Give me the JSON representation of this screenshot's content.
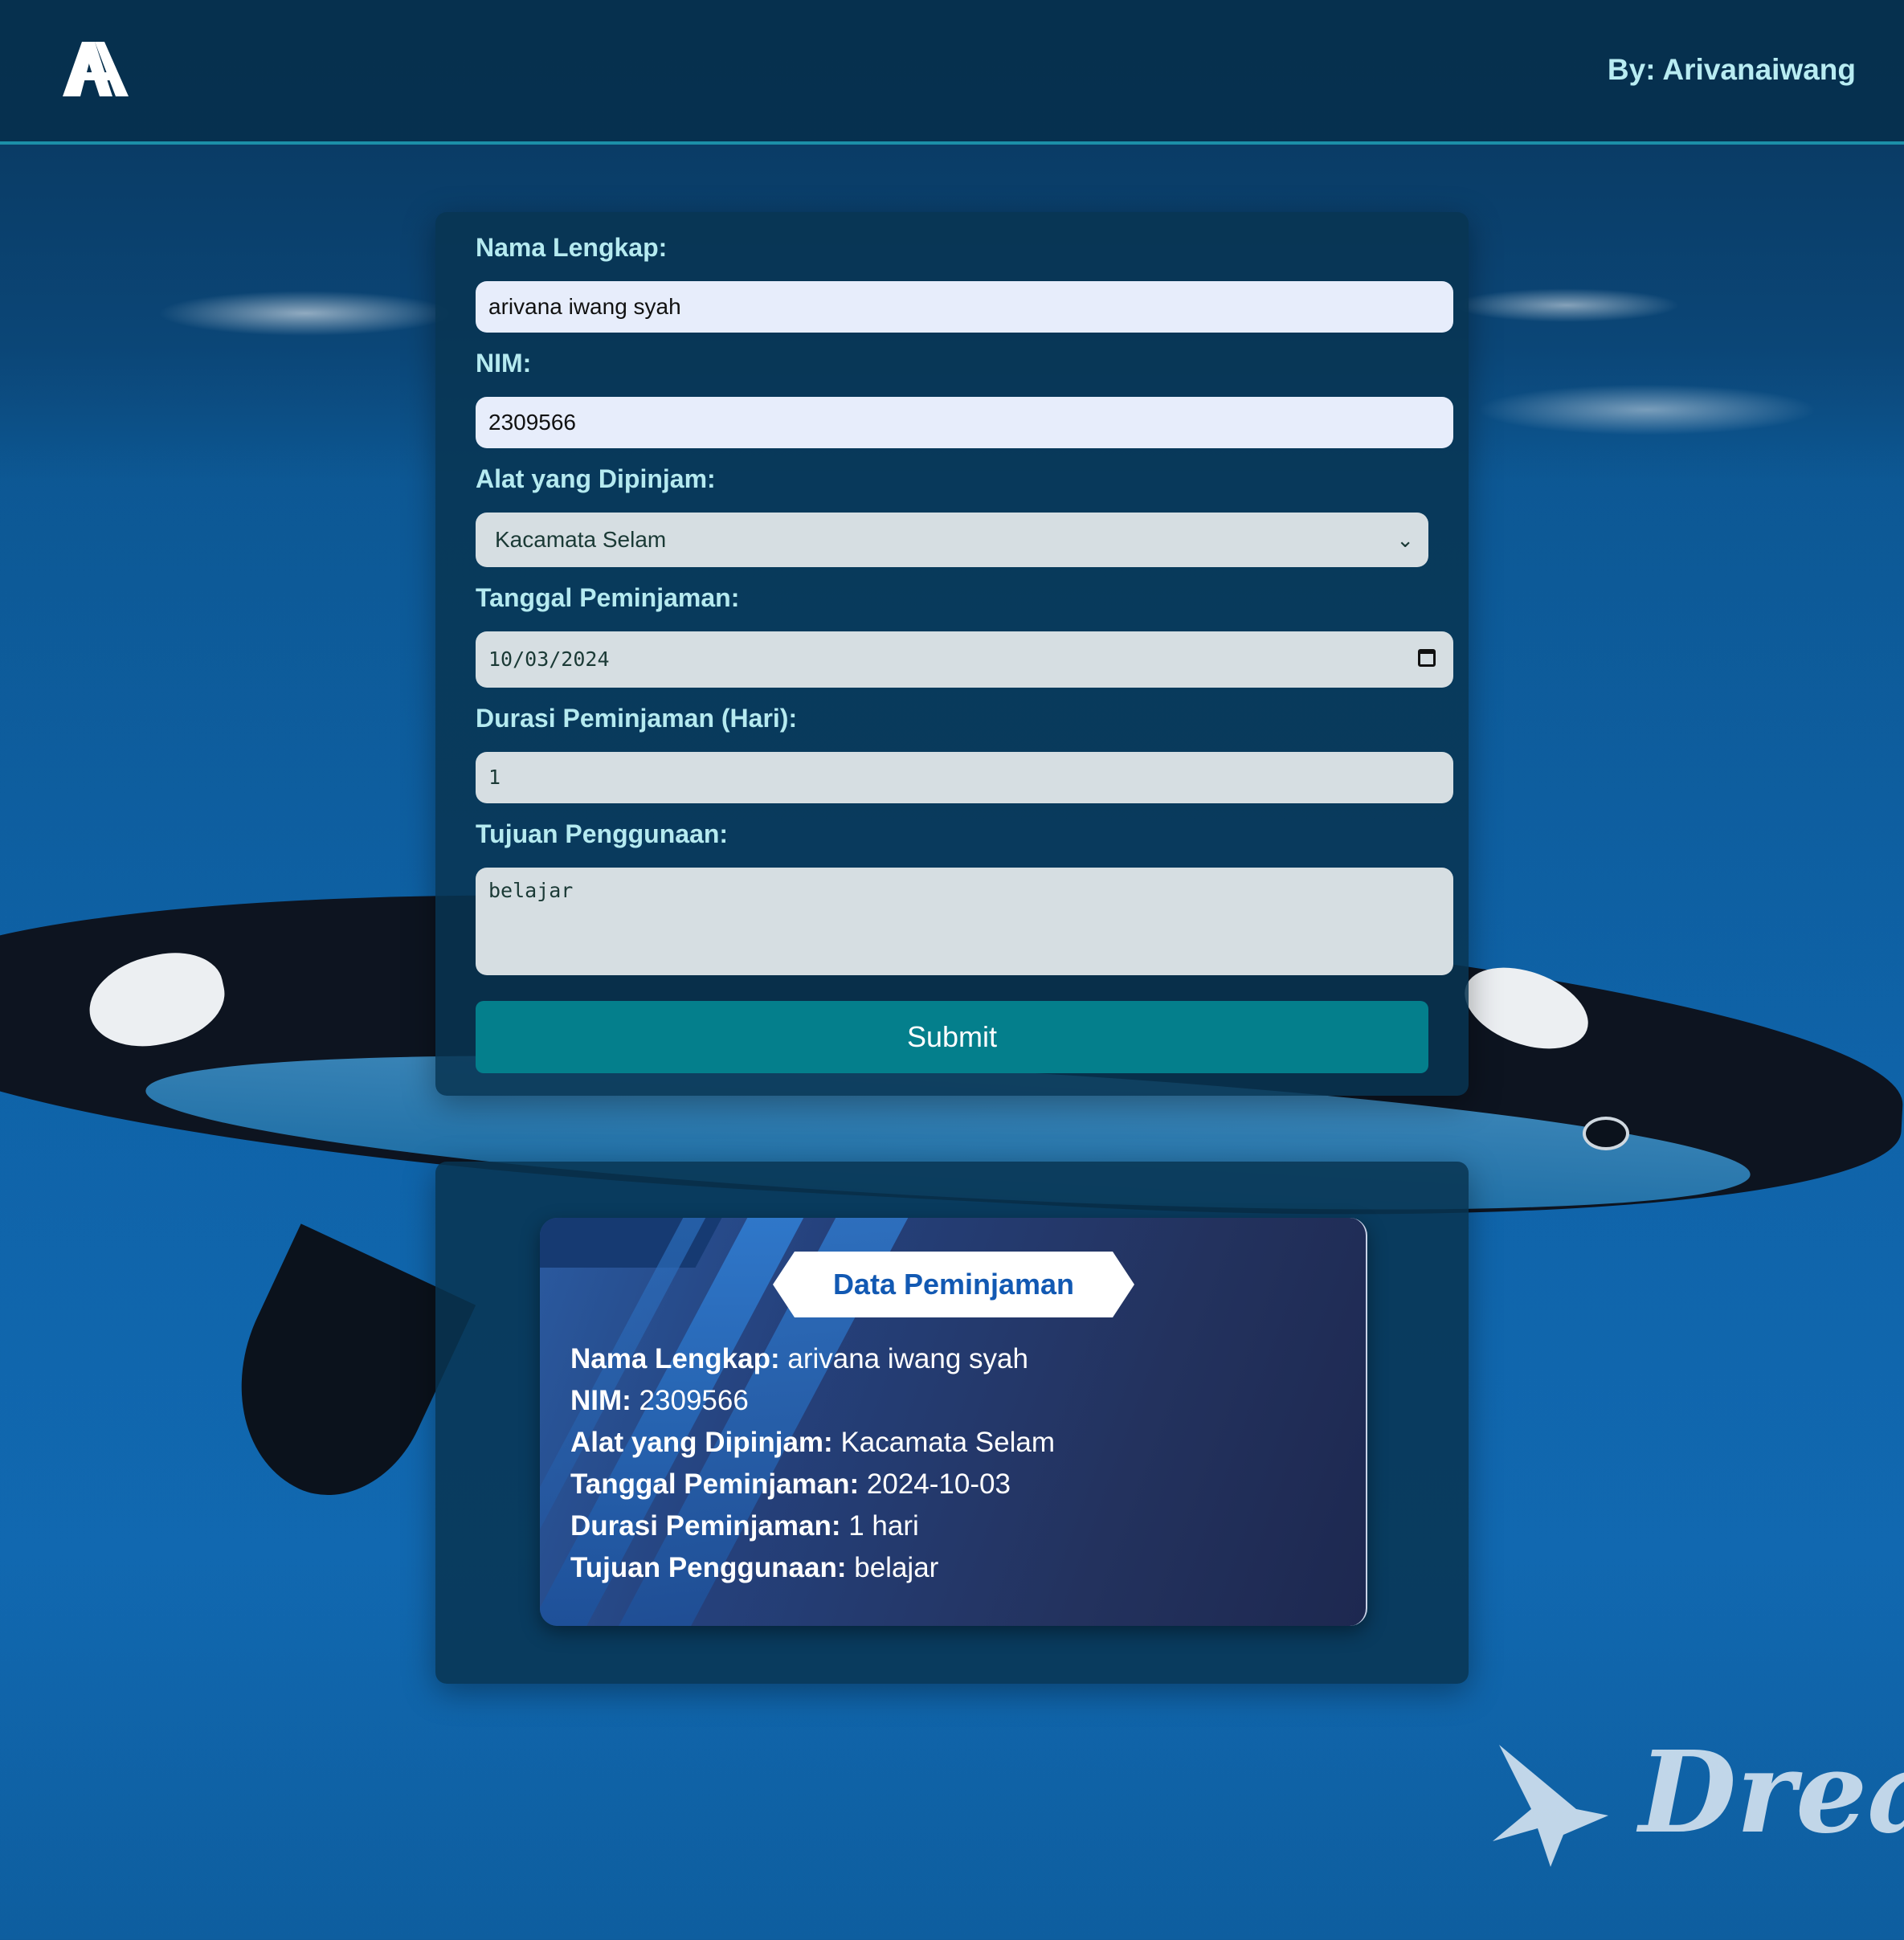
{
  "header": {
    "byline": "By: Arivanaiwang"
  },
  "form": {
    "nama_label": "Nama Lengkap:",
    "nama_value": "arivana iwang syah",
    "nim_label": "NIM:",
    "nim_value": "2309566",
    "alat_label": "Alat yang Dipinjam:",
    "alat_selected": "Kacamata Selam",
    "tanggal_label": "Tanggal Peminjaman:",
    "tanggal_value": "10/03/2024",
    "durasi_label": "Durasi Peminjaman (Hari):",
    "durasi_value": "1",
    "tujuan_label": "Tujuan Penggunaan:",
    "tujuan_value": "belajar",
    "submit_label": "Submit"
  },
  "result": {
    "title": "Data Peminjaman",
    "rows": [
      {
        "label": "Nama Lengkap:",
        "value": "arivana iwang syah"
      },
      {
        "label": "NIM:",
        "value": "2309566"
      },
      {
        "label": "Alat yang Dipinjam:",
        "value": "Kacamata Selam"
      },
      {
        "label": "Tanggal Peminjaman:",
        "value": "2024-10-03"
      },
      {
        "label": "Durasi Peminjaman:",
        "value": "1 hari"
      },
      {
        "label": "Tujuan Penggunaan:",
        "value": "belajar"
      }
    ]
  },
  "background": {
    "watermark_text": "Drea"
  },
  "colors": {
    "accent": "#047f8c",
    "label": "#b5eaf0",
    "header_bg": "#062e4a",
    "title_text": "#1259b3"
  },
  "icons": {
    "logo": "aa-logo-icon",
    "select_arrow": "chevron-down-icon",
    "date_picker": "calendar-icon"
  }
}
